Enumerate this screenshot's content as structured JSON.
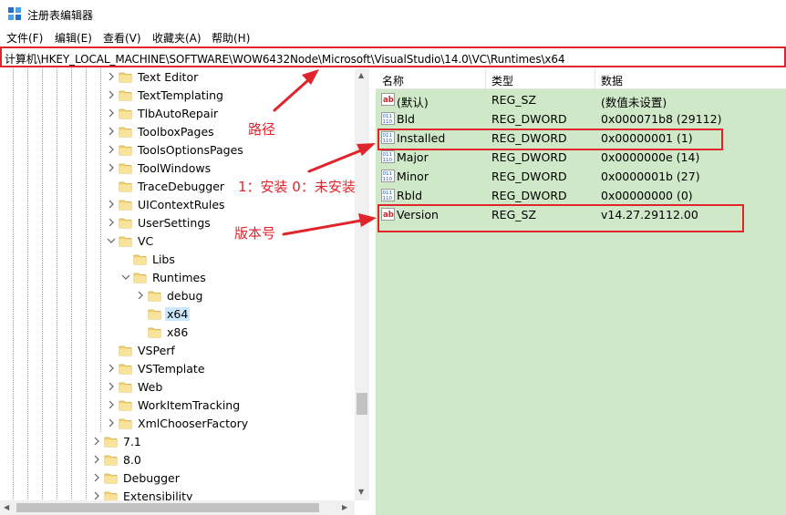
{
  "window": {
    "title": "注册表编辑器",
    "icon": "registry-editor-icon"
  },
  "menu": [
    "文件(F)",
    "编辑(E)",
    "查看(V)",
    "收藏夹(A)",
    "帮助(H)"
  ],
  "address": "计算机\\HKEY_LOCAL_MACHINE\\SOFTWARE\\WOW6432Node\\Microsoft\\VisualStudio\\14.0\\VC\\Runtimes\\x64",
  "tree": {
    "items": [
      {
        "label": "Text Editor",
        "expander": "collapsed"
      },
      {
        "label": "TextTemplating",
        "expander": "collapsed"
      },
      {
        "label": "TlbAutoRepair",
        "expander": "collapsed"
      },
      {
        "label": "ToolboxPages",
        "expander": "collapsed"
      },
      {
        "label": "ToolsOptionsPages",
        "expander": "collapsed"
      },
      {
        "label": "ToolWindows",
        "expander": "collapsed"
      },
      {
        "label": "TraceDebugger",
        "expander": "none"
      },
      {
        "label": "UIContextRules",
        "expander": "collapsed"
      },
      {
        "label": "UserSettings",
        "expander": "collapsed"
      },
      {
        "label": "VC",
        "expander": "expanded"
      },
      {
        "label": "Libs",
        "expander": "none"
      },
      {
        "label": "Runtimes",
        "expander": "expanded"
      },
      {
        "label": "debug",
        "expander": "collapsed"
      },
      {
        "label": "x64",
        "expander": "none",
        "selected": true
      },
      {
        "label": "x86",
        "expander": "none"
      },
      {
        "label": "VSPerf",
        "expander": "none"
      },
      {
        "label": "VSTemplate",
        "expander": "collapsed"
      },
      {
        "label": "Web",
        "expander": "collapsed"
      },
      {
        "label": "WorkItemTracking",
        "expander": "collapsed"
      },
      {
        "label": "XmlChooserFactory",
        "expander": "collapsed"
      },
      {
        "label": "7.1",
        "expander": "collapsed"
      },
      {
        "label": "8.0",
        "expander": "collapsed"
      },
      {
        "label": "Debugger",
        "expander": "collapsed"
      },
      {
        "label": "Extensibility",
        "expander": "collapsed"
      }
    ]
  },
  "list": {
    "columns": [
      "名称",
      "类型",
      "数据"
    ],
    "rows": [
      {
        "name": "(默认)",
        "type": "REG_SZ",
        "data": "(数值未设置)",
        "icon": "string-value-icon"
      },
      {
        "name": "Bld",
        "type": "REG_DWORD",
        "data": "0x000071b8 (29112)",
        "icon": "dword-value-icon"
      },
      {
        "name": "Installed",
        "type": "REG_DWORD",
        "data": "0x00000001 (1)",
        "icon": "dword-value-icon"
      },
      {
        "name": "Major",
        "type": "REG_DWORD",
        "data": "0x0000000e (14)",
        "icon": "dword-value-icon"
      },
      {
        "name": "Minor",
        "type": "REG_DWORD",
        "data": "0x0000001b (27)",
        "icon": "dword-value-icon"
      },
      {
        "name": "Rbld",
        "type": "REG_DWORD",
        "data": "0x00000000 (0)",
        "icon": "dword-value-icon"
      },
      {
        "name": "Version",
        "type": "REG_SZ",
        "data": "v14.27.29112.00",
        "icon": "string-value-icon"
      }
    ]
  },
  "annotations": {
    "path": "路径",
    "installed": "1：安装 0：未安装",
    "version": "版本号",
    "color": "#e0242b"
  },
  "colors": {
    "list_background": "#cfe8c8",
    "selection": "#cce8ff",
    "folder": "#f5d67a"
  }
}
